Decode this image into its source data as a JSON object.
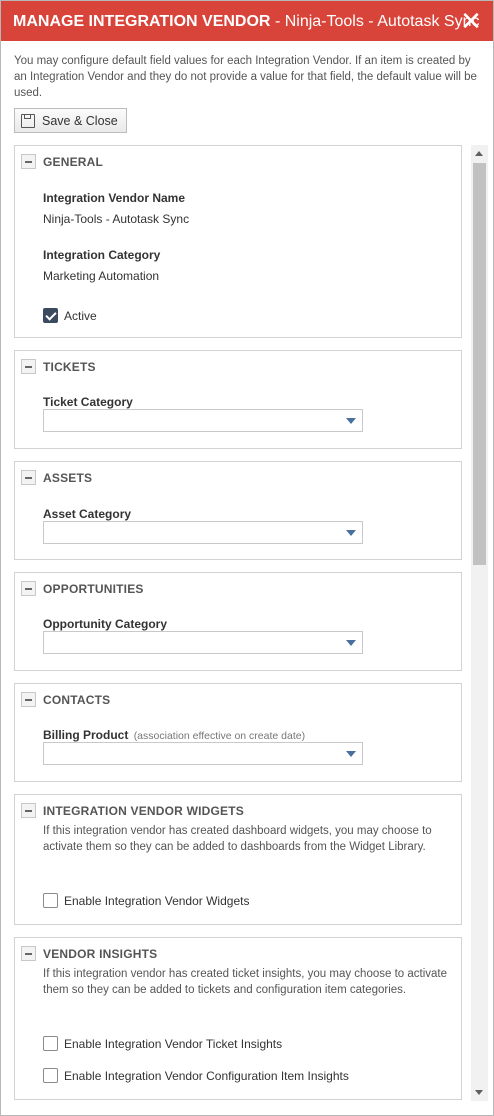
{
  "dialog": {
    "title_main": "MANAGE INTEGRATION VENDOR",
    "title_sub": "- Ninja-Tools - Autotask Sync",
    "close_icon": "close-icon",
    "accent_color": "#d9443a"
  },
  "intro": "You may configure default field values for each Integration Vendor. If an item is created by an Integration Vendor and they do not provide a value for that field, the default value will be used.",
  "toolbar": {
    "save_label": "Save & Close",
    "save_icon": "save-icon"
  },
  "general": {
    "title": "GENERAL",
    "vendor_name_label": "Integration Vendor Name",
    "vendor_name_value": "Ninja-Tools - Autotask Sync",
    "category_label": "Integration Category",
    "category_value": "Marketing Automation",
    "active_label": "Active",
    "active_checked": true
  },
  "tickets": {
    "title": "TICKETS",
    "field_label": "Ticket Category",
    "value": ""
  },
  "assets": {
    "title": "ASSETS",
    "field_label": "Asset Category",
    "value": ""
  },
  "opportunities": {
    "title": "OPPORTUNITIES",
    "field_label": "Opportunity Category",
    "value": ""
  },
  "contacts": {
    "title": "CONTACTS",
    "field_label": "Billing Product",
    "field_hint": "(association effective on create date)",
    "value": ""
  },
  "widgets": {
    "title": "INTEGRATION VENDOR WIDGETS",
    "description": "If this integration vendor has created dashboard widgets, you may choose to activate them so they can be added to dashboards from the Widget Library.",
    "checkbox_label": "Enable Integration Vendor Widgets",
    "checked": false
  },
  "insights": {
    "title": "VENDOR INSIGHTS",
    "description": "If this integration vendor has created ticket insights, you may choose to activate them so they can be added to tickets and configuration item categories.",
    "ticket_checkbox_label": "Enable Integration Vendor Ticket Insights",
    "ticket_checked": false,
    "ci_checkbox_label": "Enable Integration Vendor Configuration Item Insights",
    "ci_checked": false
  }
}
